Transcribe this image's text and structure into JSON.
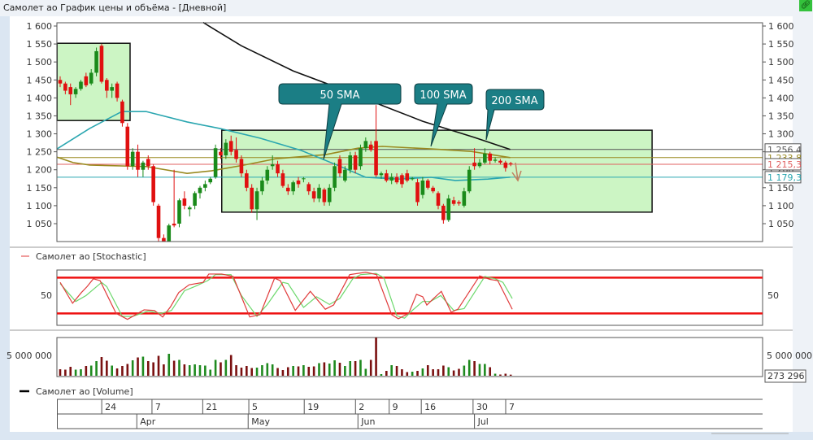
{
  "window": {
    "title": "Самолет ао График цены и объёма - [Дневной]",
    "link_icon": "link-icon"
  },
  "colors": {
    "up": "#1a8a1a",
    "down": "#e01010",
    "vol_up": "#1f8a1f",
    "vol_down": "#7a1010",
    "sma50": "#2aa6b0",
    "sma100": "#9a8a20",
    "sma200": "#111111",
    "box": "#ccf5c4",
    "callout": "#1b7e85",
    "stoch_k": "#e03a3a",
    "stoch_d": "#6cd86c",
    "levels": "#ee1111"
  },
  "price_panel": {
    "yticks": [
      "1 600",
      "1 550",
      "1 500",
      "1 450",
      "1 400",
      "1 350",
      "1 300",
      "1 250",
      "1 200",
      "1 150",
      "1 100",
      "1 050"
    ],
    "ytick_values": [
      1600,
      1550,
      1500,
      1450,
      1400,
      1350,
      1300,
      1250,
      1200,
      1150,
      1100,
      1050
    ],
    "last_labels": [
      {
        "text": "1 256,4",
        "value": 1256.4,
        "color": "#555555"
      },
      {
        "text": "1 233,8",
        "value": 1233.8,
        "color": "#9a8a20"
      },
      {
        "text": "1 215,3",
        "value": 1215.3,
        "color": "#e06060"
      },
      {
        "text": "1 179,3",
        "value": 1179.3,
        "color": "#2aa6b0"
      }
    ],
    "callouts": {
      "sma50": "50 SMA",
      "sma100": "100 SMA",
      "sma200": "200 SMA"
    }
  },
  "stoch_panel": {
    "legend": "Самолет ао [Stochastic]",
    "ytick": "50",
    "levels": [
      80,
      20
    ]
  },
  "volume_panel": {
    "legend": "Самолет ао [Volume]",
    "ytick": "5 000 000",
    "last_label": "273 296"
  },
  "x_axis": {
    "day_ticks": [
      {
        "label": "24",
        "i": 8.5
      },
      {
        "label": "7",
        "i": 18.2
      },
      {
        "label": "21",
        "i": 28
      },
      {
        "label": "5",
        "i": 36.9
      },
      {
        "label": "19",
        "i": 47.6
      },
      {
        "label": "2",
        "i": 57.5
      },
      {
        "label": "9",
        "i": 64
      },
      {
        "label": "16",
        "i": 70.2
      },
      {
        "label": "30",
        "i": 80.2
      },
      {
        "label": "7",
        "i": 86.5
      }
    ],
    "month_ticks": [
      {
        "label": "Apr",
        "i": 14.8
      },
      {
        "label": "May",
        "i": 36.3
      },
      {
        "label": "Jun",
        "i": 57.5
      },
      {
        "label": "Jul",
        "i": 80
      }
    ]
  },
  "chart_data": {
    "type": "candlestick",
    "title": "Самолет ао График цены и объёма - [Дневной]",
    "ylim": [
      1000,
      1610
    ],
    "ohlc": [
      [
        1450,
        1460,
        1430,
        1440
      ],
      [
        1440,
        1445,
        1410,
        1420
      ],
      [
        1430,
        1440,
        1380,
        1410
      ],
      [
        1410,
        1430,
        1400,
        1425
      ],
      [
        1425,
        1450,
        1420,
        1445
      ],
      [
        1460,
        1470,
        1430,
        1435
      ],
      [
        1440,
        1480,
        1435,
        1470
      ],
      [
        1470,
        1540,
        1460,
        1530
      ],
      [
        1545,
        1550,
        1440,
        1445
      ],
      [
        1450,
        1455,
        1400,
        1420
      ],
      [
        1420,
        1440,
        1400,
        1430
      ],
      [
        1440,
        1445,
        1390,
        1400
      ],
      [
        1390,
        1395,
        1320,
        1330
      ],
      [
        1320,
        1330,
        1200,
        1210
      ],
      [
        1210,
        1260,
        1200,
        1250
      ],
      [
        1250,
        1270,
        1180,
        1200
      ],
      [
        1200,
        1225,
        1180,
        1220
      ],
      [
        1230,
        1240,
        1200,
        1210
      ],
      [
        1210,
        1215,
        1100,
        1110
      ],
      [
        1100,
        1105,
        1000,
        1010
      ],
      [
        1010,
        1020,
        990,
        995
      ],
      [
        1000,
        1050,
        995,
        1045
      ],
      [
        1050,
        1200,
        1040,
        1045
      ],
      [
        1050,
        1120,
        1040,
        1115
      ],
      [
        1120,
        1140,
        1090,
        1100
      ],
      [
        1090,
        1100,
        1070,
        1095
      ],
      [
        1100,
        1140,
        1090,
        1135
      ],
      [
        1135,
        1155,
        1120,
        1150
      ],
      [
        1150,
        1170,
        1140,
        1160
      ],
      [
        1165,
        1180,
        1160,
        1175
      ],
      [
        1180,
        1270,
        1175,
        1260
      ],
      [
        1250,
        1260,
        1230,
        1240
      ],
      [
        1240,
        1285,
        1230,
        1275
      ],
      [
        1280,
        1295,
        1240,
        1250
      ],
      [
        1255,
        1290,
        1220,
        1230
      ],
      [
        1230,
        1240,
        1180,
        1190
      ],
      [
        1190,
        1200,
        1140,
        1150
      ],
      [
        1150,
        1160,
        1080,
        1090
      ],
      [
        1090,
        1150,
        1060,
        1140
      ],
      [
        1140,
        1180,
        1130,
        1170
      ],
      [
        1170,
        1210,
        1160,
        1200
      ],
      [
        1210,
        1240,
        1200,
        1215
      ],
      [
        1215,
        1225,
        1180,
        1190
      ],
      [
        1190,
        1200,
        1150,
        1155
      ],
      [
        1150,
        1160,
        1130,
        1140
      ],
      [
        1140,
        1170,
        1130,
        1165
      ],
      [
        1170,
        1180,
        1150,
        1160
      ],
      [
        1175,
        1180,
        1165,
        1176
      ],
      [
        1160,
        1165,
        1130,
        1140
      ],
      [
        1140,
        1150,
        1110,
        1120
      ],
      [
        1120,
        1160,
        1110,
        1150
      ],
      [
        1145,
        1150,
        1100,
        1110
      ],
      [
        1110,
        1160,
        1100,
        1150
      ],
      [
        1150,
        1220,
        1140,
        1210
      ],
      [
        1230,
        1240,
        1180,
        1190
      ],
      [
        1170,
        1210,
        1165,
        1200
      ],
      [
        1200,
        1250,
        1190,
        1240
      ],
      [
        1240,
        1250,
        1190,
        1200
      ],
      [
        1210,
        1270,
        1200,
        1260
      ],
      [
        1260,
        1290,
        1250,
        1280
      ],
      [
        1270,
        1280,
        1250,
        1255
      ],
      [
        1280,
        1380,
        1180,
        1185
      ],
      [
        1185,
        1195,
        1175,
        1190
      ],
      [
        1190,
        1200,
        1165,
        1170
      ],
      [
        1170,
        1190,
        1160,
        1180
      ],
      [
        1180,
        1190,
        1160,
        1165
      ],
      [
        1185,
        1190,
        1150,
        1160
      ],
      [
        1190,
        1200,
        1165,
        1170
      ],
      [
        1174,
        1180,
        1170,
        1176
      ],
      [
        1165,
        1175,
        1100,
        1110
      ],
      [
        1130,
        1180,
        1120,
        1170
      ],
      [
        1170,
        1175,
        1145,
        1150
      ],
      [
        1150,
        1155,
        1135,
        1140
      ],
      [
        1135,
        1140,
        1090,
        1100
      ],
      [
        1100,
        1105,
        1050,
        1060
      ],
      [
        1060,
        1130,
        1055,
        1120
      ],
      [
        1115,
        1125,
        1100,
        1105
      ],
      [
        1110,
        1115,
        1100,
        1106
      ],
      [
        1100,
        1150,
        1095,
        1140
      ],
      [
        1140,
        1210,
        1135,
        1200
      ],
      [
        1220,
        1260,
        1200,
        1210
      ],
      [
        1210,
        1230,
        1205,
        1220
      ],
      [
        1220,
        1260,
        1215,
        1245
      ],
      [
        1245,
        1250,
        1215,
        1225
      ],
      [
        1225,
        1235,
        1220,
        1228
      ],
      [
        1225,
        1230,
        1215,
        1220
      ],
      [
        1220,
        1225,
        1195,
        1205
      ],
      [
        1218,
        1222,
        1210,
        1215.3
      ]
    ],
    "sma": [
      {
        "name": "200 SMA",
        "points": [
          [
            27.6,
            1610
          ],
          [
            35,
            1545
          ],
          [
            45,
            1475
          ],
          [
            57,
            1410
          ],
          [
            62,
            1380
          ],
          [
            70,
            1335
          ],
          [
            80,
            1290
          ],
          [
            86.9,
            1256.4
          ]
        ]
      },
      {
        "name": "100 SMA",
        "points": [
          [
            -0.6,
            1235
          ],
          [
            2.5,
            1220
          ],
          [
            5.7,
            1213
          ],
          [
            16.6,
            1209
          ],
          [
            24.5,
            1190
          ],
          [
            29.2,
            1197
          ],
          [
            35.5,
            1213
          ],
          [
            41.8,
            1231
          ],
          [
            51.2,
            1242
          ],
          [
            57.5,
            1260
          ],
          [
            62.2,
            1265
          ],
          [
            71.6,
            1258
          ],
          [
            79.4,
            1251
          ],
          [
            86.9,
            1233.8
          ]
        ]
      },
      {
        "name": "50 SMA",
        "points": [
          [
            -0.6,
            1258
          ],
          [
            5.7,
            1315
          ],
          [
            11.9,
            1362
          ],
          [
            16.6,
            1362
          ],
          [
            24.5,
            1333
          ],
          [
            30.8,
            1315
          ],
          [
            38.6,
            1288
          ],
          [
            46.5,
            1254
          ],
          [
            54.3,
            1208
          ],
          [
            59,
            1179
          ],
          [
            65.3,
            1174
          ],
          [
            71.6,
            1179
          ],
          [
            76.3,
            1170
          ],
          [
            82.6,
            1174
          ],
          [
            86.9,
            1179.3
          ]
        ]
      }
    ],
    "annotations": [
      {
        "type": "rect",
        "i": [
          -0.6,
          13.5
        ],
        "price": [
          1337,
          1552
        ]
      },
      {
        "type": "rect",
        "i": [
          31.2,
          114.3
        ],
        "price": [
          1082,
          1310
        ]
      }
    ],
    "stochastic": {
      "k": [
        [
          0,
          72
        ],
        [
          2.4,
          37
        ],
        [
          4.1,
          55
        ],
        [
          5.2,
          65
        ],
        [
          6.4,
          78
        ],
        [
          7.7,
          75
        ],
        [
          10.8,
          20
        ],
        [
          13,
          10
        ],
        [
          16.2,
          26
        ],
        [
          18.2,
          25
        ],
        [
          19.8,
          14
        ],
        [
          21.3,
          31
        ],
        [
          22.9,
          55
        ],
        [
          24.9,
          68
        ],
        [
          27.6,
          72
        ],
        [
          28.7,
          86
        ],
        [
          31.2,
          86
        ],
        [
          33.4,
          82
        ],
        [
          36.6,
          14
        ],
        [
          38.6,
          18
        ],
        [
          41.4,
          79
        ],
        [
          42.5,
          75
        ],
        [
          45.4,
          25
        ],
        [
          48.3,
          57
        ],
        [
          51.2,
          27
        ],
        [
          52.8,
          34
        ],
        [
          55.9,
          85
        ],
        [
          59,
          89
        ],
        [
          61.1,
          85
        ],
        [
          64,
          18
        ],
        [
          65.3,
          11
        ],
        [
          67.3,
          20
        ],
        [
          68.8,
          52
        ],
        [
          70,
          48
        ],
        [
          70.8,
          34
        ],
        [
          72.1,
          45
        ],
        [
          73.6,
          57
        ],
        [
          75.5,
          22
        ],
        [
          76.8,
          27
        ],
        [
          81,
          83
        ],
        [
          83,
          77
        ],
        [
          84.5,
          75
        ],
        [
          87.3,
          27
        ]
      ],
      "d": [
        [
          0,
          70
        ],
        [
          3,
          40
        ],
        [
          5,
          50
        ],
        [
          8,
          72
        ],
        [
          9,
          65
        ],
        [
          12,
          15
        ],
        [
          14,
          15
        ],
        [
          17,
          24
        ],
        [
          19.5,
          20
        ],
        [
          21.5,
          25
        ],
        [
          24,
          58
        ],
        [
          26,
          65
        ],
        [
          28.5,
          75
        ],
        [
          30,
          85
        ],
        [
          33,
          85
        ],
        [
          35,
          50
        ],
        [
          38,
          15
        ],
        [
          40,
          35
        ],
        [
          43,
          72
        ],
        [
          44,
          70
        ],
        [
          47,
          30
        ],
        [
          49.5,
          48
        ],
        [
          52,
          35
        ],
        [
          54,
          45
        ],
        [
          56.5,
          78
        ],
        [
          58,
          85
        ],
        [
          61,
          87
        ],
        [
          62.5,
          80
        ],
        [
          65,
          16
        ],
        [
          66.5,
          12
        ],
        [
          68,
          25
        ],
        [
          70,
          40
        ],
        [
          71.5,
          40
        ],
        [
          73.5,
          50
        ],
        [
          76,
          25
        ],
        [
          78,
          28
        ],
        [
          82,
          82
        ],
        [
          84,
          78
        ],
        [
          85.5,
          72
        ],
        [
          87.3,
          45
        ]
      ],
      "ylim": [
        0,
        93
      ]
    },
    "volume_millions": [
      1.6,
      1.5,
      2.2,
      1.5,
      1.6,
      2.4,
      2.5,
      3.6,
      4.6,
      3.7,
      2.5,
      1.8,
      2.4,
      2.9,
      3.8,
      4.5,
      4.7,
      3.6,
      3.3,
      4.9,
      2.8,
      5.4,
      3.7,
      3.9,
      2.8,
      2.6,
      2.8,
      2.6,
      2.5,
      1.5,
      3.9,
      3.3,
      3.9,
      5.1,
      2.6,
      2.0,
      2.4,
      1.9,
      2.0,
      2.6,
      3.1,
      2.8,
      1.9,
      1.4,
      2.1,
      2.4,
      2.3,
      2.6,
      2.2,
      2.3,
      3.1,
      3.3,
      3.0,
      3.8,
      3.2,
      2.4,
      3.6,
      3.6,
      3.9,
      1.7,
      3.9,
      9.4,
      0.4,
      1.2,
      2.6,
      2.4,
      1.6,
      0.9,
      1.0,
      1.2,
      1.8,
      2.6,
      1.6,
      1.6,
      2.5,
      2.1,
      1.3,
      1.7,
      2.5,
      3.9,
      3.6,
      2.9,
      2.9,
      2.1,
      0.5,
      0.3,
      0.5,
      0.27
    ]
  }
}
